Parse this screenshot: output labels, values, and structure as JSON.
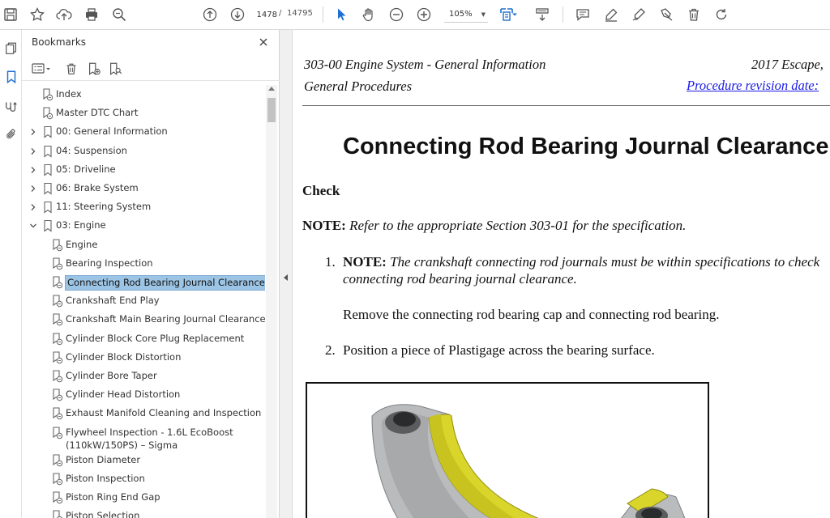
{
  "toolbar": {
    "page_current": "1478",
    "page_total": "14795",
    "page_separator": "/",
    "zoom": "105%",
    "icons": [
      "save-icon",
      "bookmark-star-icon",
      "upload-icon",
      "print-icon",
      "zoom-search-icon",
      "page-up-icon",
      "page-down-icon",
      "select-arrow-icon",
      "hand-icon",
      "zoom-out-icon",
      "zoom-in-icon",
      "fit-page-icon",
      "scroll-mode-icon",
      "comment-icon",
      "highlight-pen-icon",
      "draw-icon",
      "stamp-icon",
      "delete-icon",
      "rotate-icon"
    ]
  },
  "rail": {
    "icons": [
      "pages-icon",
      "bookmarks-icon",
      "signatures-icon",
      "attachments-icon"
    ]
  },
  "bookmarks": {
    "title": "Bookmarks",
    "items": [
      {
        "label": "Index",
        "level": 0,
        "expand": "none"
      },
      {
        "label": "Master DTC Chart",
        "level": 0,
        "expand": "none"
      },
      {
        "label": "00: General Information",
        "level": 0,
        "expand": "collapsed"
      },
      {
        "label": "04: Suspension",
        "level": 0,
        "expand": "collapsed"
      },
      {
        "label": "05: Driveline",
        "level": 0,
        "expand": "collapsed"
      },
      {
        "label": "06: Brake System",
        "level": 0,
        "expand": "collapsed"
      },
      {
        "label": "11: Steering System",
        "level": 0,
        "expand": "collapsed"
      },
      {
        "label": "03: Engine",
        "level": 0,
        "expand": "expanded"
      },
      {
        "label": "Engine",
        "level": 1,
        "expand": "none"
      },
      {
        "label": "Bearing Inspection",
        "level": 1,
        "expand": "none"
      },
      {
        "label": "Connecting Rod Bearing Journal Clearance",
        "level": 1,
        "expand": "none",
        "selected": true
      },
      {
        "label": "Crankshaft End Play",
        "level": 1,
        "expand": "none"
      },
      {
        "label": "Crankshaft Main Bearing Journal Clearance",
        "level": 1,
        "expand": "none"
      },
      {
        "label": "Cylinder Block Core Plug Replacement",
        "level": 1,
        "expand": "none"
      },
      {
        "label": "Cylinder Block Distortion",
        "level": 1,
        "expand": "none"
      },
      {
        "label": "Cylinder Bore Taper",
        "level": 1,
        "expand": "none"
      },
      {
        "label": "Cylinder Head Distortion",
        "level": 1,
        "expand": "none"
      },
      {
        "label": "Exhaust Manifold Cleaning and Inspection",
        "level": 1,
        "expand": "none"
      },
      {
        "label": "Flywheel Inspection - 1.6L EcoBoost",
        "label2": "(110kW/150PS) – Sigma",
        "level": 1,
        "expand": "none"
      },
      {
        "label": "Piston Diameter",
        "level": 1,
        "expand": "none"
      },
      {
        "label": "Piston Inspection",
        "level": 1,
        "expand": "none"
      },
      {
        "label": "Piston Ring End Gap",
        "level": 1,
        "expand": "none"
      },
      {
        "label": "Piston Selection",
        "level": 1,
        "expand": "none"
      }
    ]
  },
  "document": {
    "header_left_1": "303-00 Engine System - General Information",
    "header_left_2": "General Procedures",
    "header_right_1": "2017 Escape,",
    "header_right_2": "Procedure revision date: ",
    "title": "Connecting Rod Bearing Journal Clearance",
    "section": "Check",
    "note_label": "NOTE:",
    "note_text": " Refer to the appropriate Section 303-01 for the specification.",
    "steps": [
      {
        "num": "1.",
        "note_label": "NOTE:",
        "note_text": " The crankshaft connecting rod journals must be within specifications to check",
        "note_text_2": "connecting rod bearing journal clearance.",
        "body": "Remove the connecting rod bearing cap and connecting rod bearing."
      },
      {
        "num": "2.",
        "body": "Position a piece of Plastigage across the bearing surface."
      }
    ],
    "colors": {
      "bearing": "#d9d52a",
      "cap": "#b9bbbd",
      "link": "#1a1ae6"
    }
  }
}
